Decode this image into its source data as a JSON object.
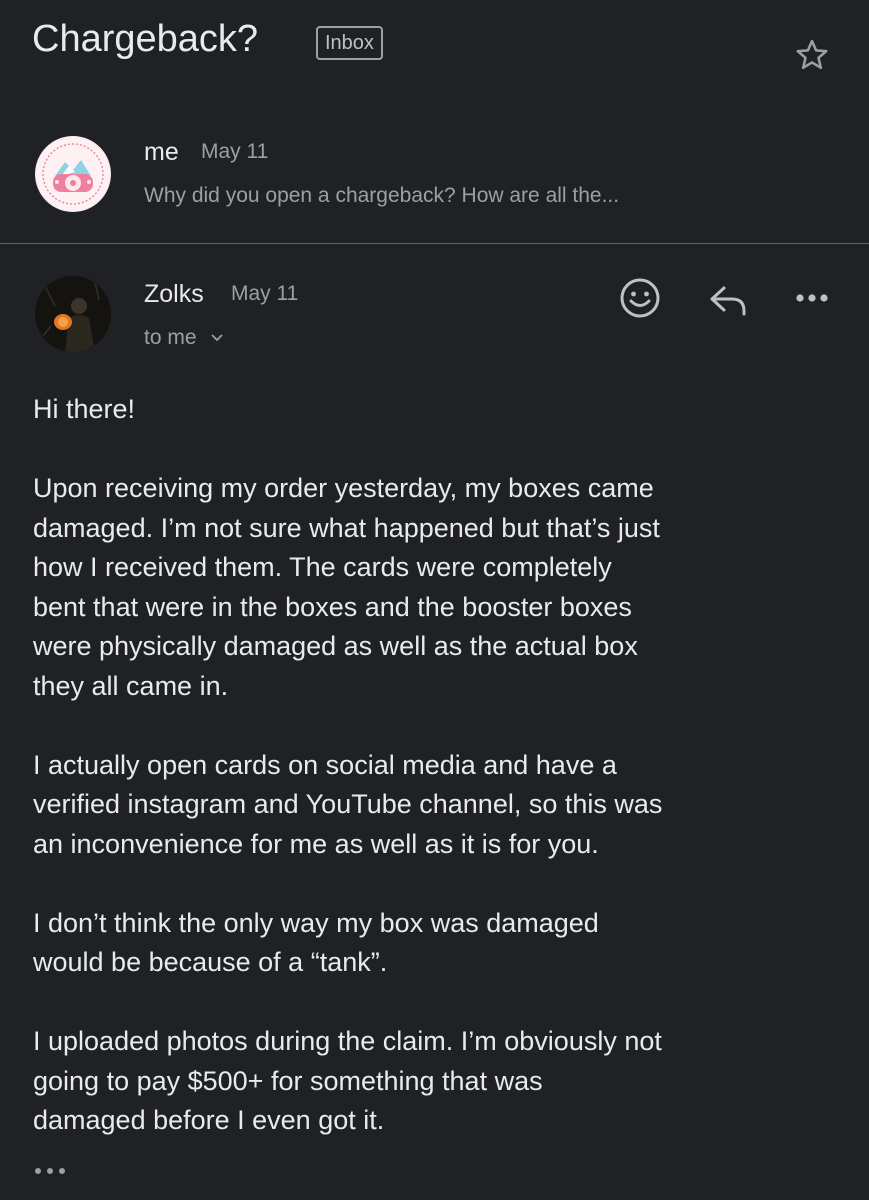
{
  "subject": {
    "title": "Chargeback?",
    "label_badge": "Inbox"
  },
  "collapsed_message": {
    "sender": "me",
    "date": "May 11",
    "snippet": "Why did you open a chargeback? How are all the..."
  },
  "open_message": {
    "sender": "Zolks",
    "date": "May 11",
    "recipient": "to me",
    "actions": [
      "emoji-reaction-icon",
      "reply-icon",
      "more-options-icon"
    ],
    "paragraphs": [
      "Hi there!",
      "Upon receiving my order yesterday, my boxes came\ndamaged. I’m not sure what happened but that’s just\nhow I received them. The cards were completely\nbent that were in the boxes and the booster boxes\nwere physically damaged as well as the actual box\nthey all came in.",
      "I actually open cards on social media and have a\nverified instagram and YouTube channel, so this was\nan inconvenience for me as well as it is for you.",
      "I don’t think the only way my box was damaged\nwould be because of a “tank”.",
      "I uploaded photos during the claim. I’m obviously not\ngoing to pay $500+ for something that was\ndamaged before I even got it."
    ]
  },
  "colors": {
    "background": "#202124",
    "text_primary": "#e8eaed",
    "text_secondary": "#9aa0a6",
    "divider": "#5f6368"
  }
}
